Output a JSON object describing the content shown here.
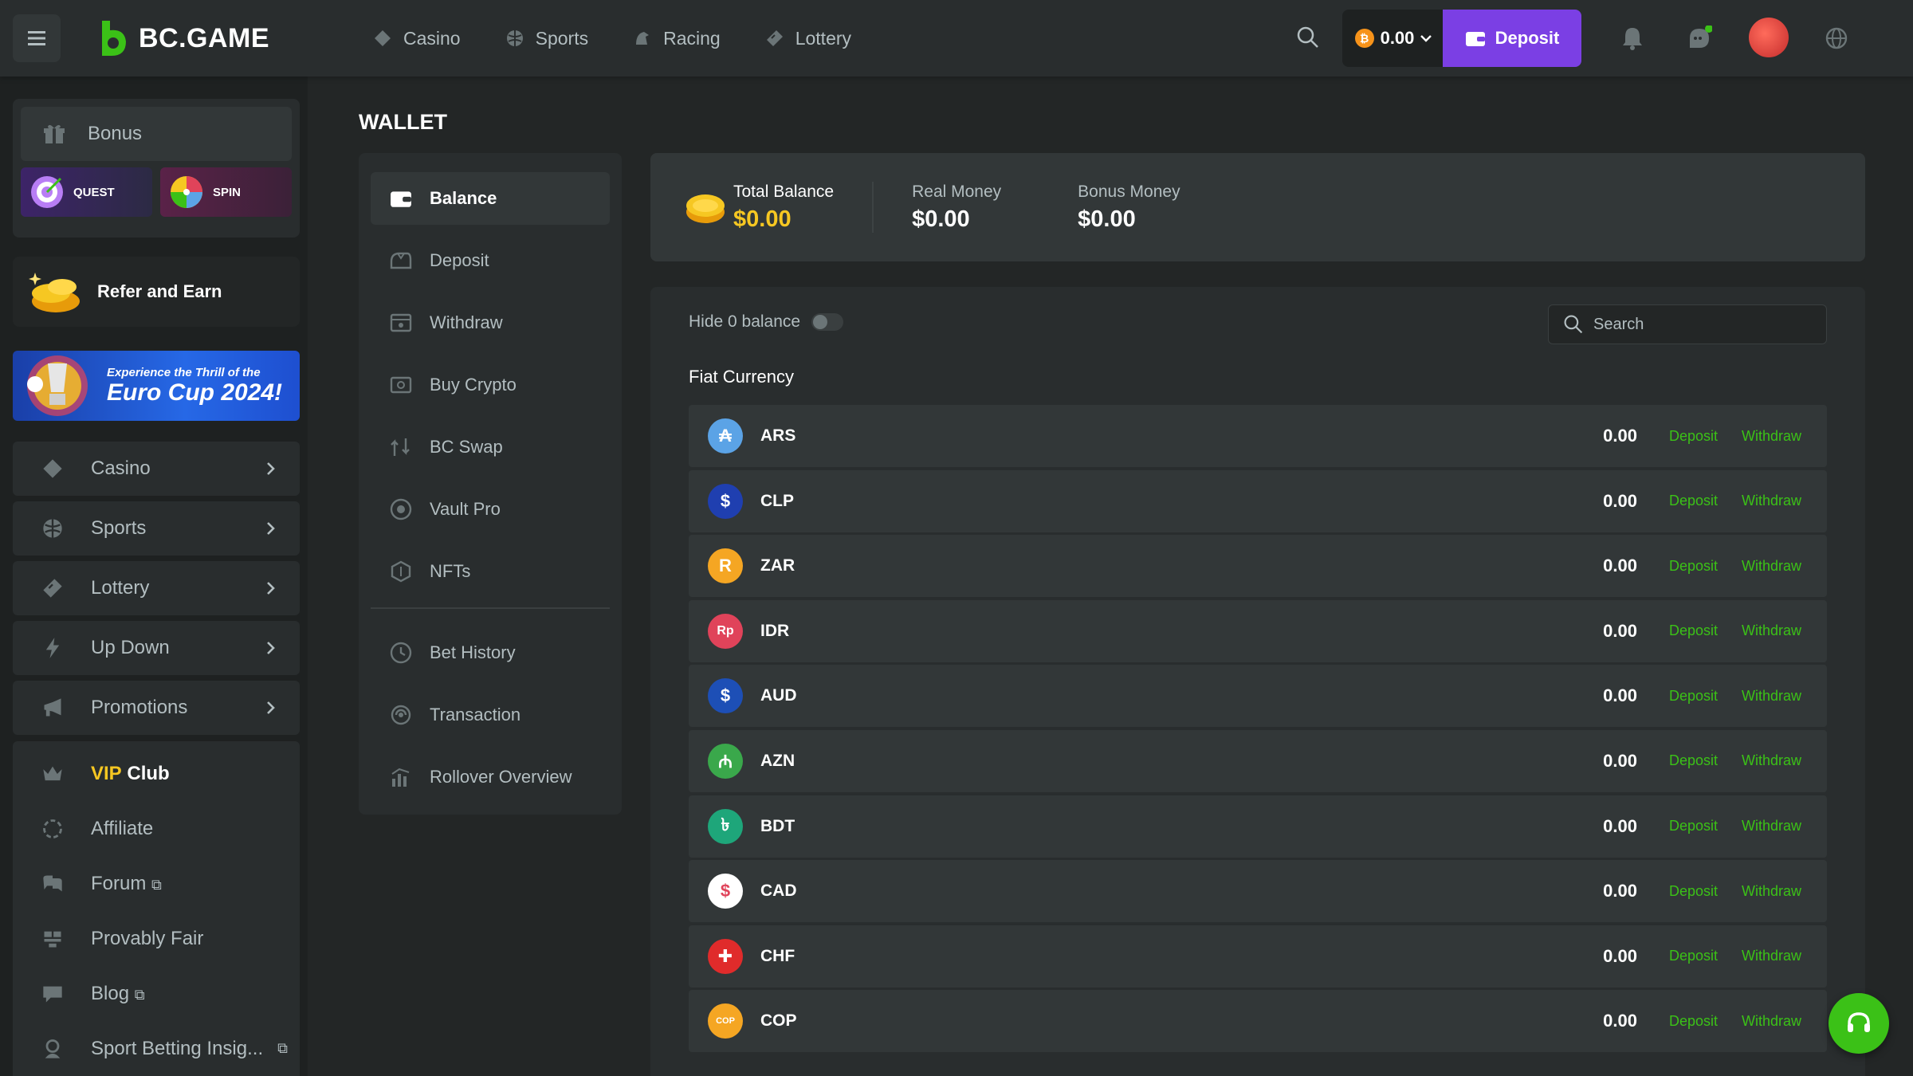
{
  "header": {
    "logo_text": "BC.GAME",
    "nav": [
      {
        "label": "Casino",
        "icon": "casino-icon"
      },
      {
        "label": "Sports",
        "icon": "sports-icon"
      },
      {
        "label": "Racing",
        "icon": "racing-icon"
      },
      {
        "label": "Lottery",
        "icon": "lottery-icon"
      }
    ],
    "balance": "0.00",
    "deposit_label": "Deposit"
  },
  "sidebar": {
    "bonus_label": "Bonus",
    "quest_label": "QUEST",
    "spin_label": "SPIN",
    "refer_label": "Refer and Earn",
    "banner_small": "Experience the Thrill of the",
    "banner_big": "Euro Cup 2024!",
    "nav": [
      {
        "label": "Casino"
      },
      {
        "label": "Sports"
      },
      {
        "label": "Lottery"
      },
      {
        "label": "Up Down"
      },
      {
        "label": "Promotions"
      }
    ],
    "vip_gold": "VIP",
    "vip_white": "Club",
    "links": [
      {
        "label": "Affiliate"
      },
      {
        "label": "Forum"
      },
      {
        "label": "Provably Fair"
      },
      {
        "label": "Blog"
      },
      {
        "label": "Sport Betting Insig..."
      }
    ]
  },
  "wallet": {
    "title": "WALLET",
    "menu": [
      {
        "label": "Balance"
      },
      {
        "label": "Deposit"
      },
      {
        "label": "Withdraw"
      },
      {
        "label": "Buy Crypto"
      },
      {
        "label": "BC Swap"
      },
      {
        "label": "Vault Pro"
      },
      {
        "label": "NFTs"
      }
    ],
    "menu2": [
      {
        "label": "Bet History"
      },
      {
        "label": "Transaction"
      },
      {
        "label": "Rollover Overview"
      }
    ]
  },
  "summary": {
    "total_label": "Total Balance",
    "total_value": "$0.00",
    "real_label": "Real Money",
    "real_value": "$0.00",
    "bonus_label": "Bonus Money",
    "bonus_value": "$0.00"
  },
  "list": {
    "hide_label": "Hide 0 balance",
    "search_placeholder": "Search",
    "section": "Fiat Currency",
    "deposit_label": "Deposit",
    "withdraw_label": "Withdraw",
    "currencies": [
      {
        "code": "ARS",
        "amount": "0.00",
        "symbol": "₳",
        "color": "#5ba3e6"
      },
      {
        "code": "CLP",
        "amount": "0.00",
        "symbol": "$",
        "color": "#1f3fb0"
      },
      {
        "code": "ZAR",
        "amount": "0.00",
        "symbol": "R",
        "color": "#f5a623"
      },
      {
        "code": "IDR",
        "amount": "0.00",
        "symbol": "Rp",
        "color": "#e0435a"
      },
      {
        "code": "AUD",
        "amount": "0.00",
        "symbol": "$",
        "color": "#1d4fb6"
      },
      {
        "code": "AZN",
        "amount": "0.00",
        "symbol": "₼",
        "color": "#3aa84b"
      },
      {
        "code": "BDT",
        "amount": "0.00",
        "symbol": "৳",
        "color": "#1ea67a"
      },
      {
        "code": "CAD",
        "amount": "0.00",
        "symbol": "$",
        "color": "#ffffff"
      },
      {
        "code": "CHF",
        "amount": "0.00",
        "symbol": "✚",
        "color": "#e02b2b"
      },
      {
        "code": "COP",
        "amount": "0.00",
        "symbol": "COP",
        "color": "#f5a623"
      }
    ]
  }
}
